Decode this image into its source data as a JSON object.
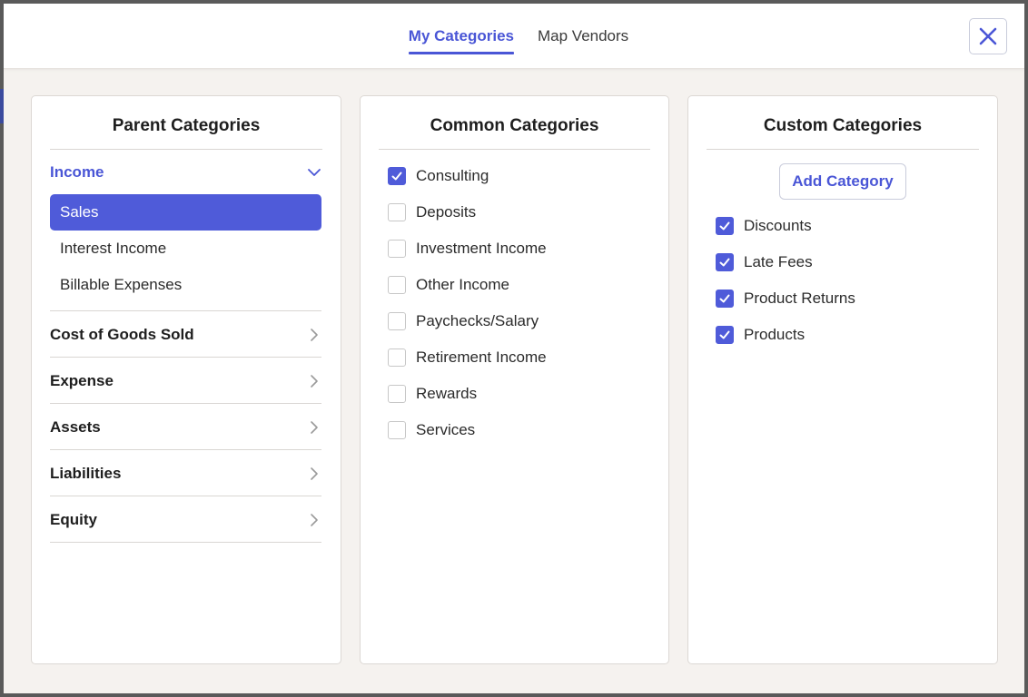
{
  "tabs": [
    {
      "label": "My Categories",
      "active": true
    },
    {
      "label": "Map Vendors",
      "active": false
    }
  ],
  "close_icon": "close-x-icon",
  "accent_color": "#4f5bd9",
  "parent_panel": {
    "title": "Parent Categories",
    "groups": [
      {
        "label": "Income",
        "expanded": true,
        "icon": "chevron-down-icon",
        "items": [
          {
            "label": "Sales",
            "selected": true
          },
          {
            "label": "Interest Income",
            "selected": false
          },
          {
            "label": "Billable Expenses",
            "selected": false
          }
        ]
      },
      {
        "label": "Cost of Goods Sold",
        "expanded": false,
        "icon": "chevron-right-icon"
      },
      {
        "label": "Expense",
        "expanded": false,
        "icon": "chevron-right-icon"
      },
      {
        "label": "Assets",
        "expanded": false,
        "icon": "chevron-right-icon"
      },
      {
        "label": "Liabilities",
        "expanded": false,
        "icon": "chevron-right-icon"
      },
      {
        "label": "Equity",
        "expanded": false,
        "icon": "chevron-right-icon"
      }
    ]
  },
  "common_panel": {
    "title": "Common Categories",
    "items": [
      {
        "label": "Consulting",
        "checked": true
      },
      {
        "label": "Deposits",
        "checked": false
      },
      {
        "label": "Investment Income",
        "checked": false
      },
      {
        "label": "Other Income",
        "checked": false
      },
      {
        "label": "Paychecks/Salary",
        "checked": false
      },
      {
        "label": "Retirement Income",
        "checked": false
      },
      {
        "label": "Rewards",
        "checked": false
      },
      {
        "label": "Services",
        "checked": false
      }
    ]
  },
  "custom_panel": {
    "title": "Custom Categories",
    "add_label": "Add Category",
    "items": [
      {
        "label": "Discounts",
        "checked": true
      },
      {
        "label": "Late Fees",
        "checked": true
      },
      {
        "label": "Product Returns",
        "checked": true
      },
      {
        "label": "Products",
        "checked": true
      }
    ]
  }
}
